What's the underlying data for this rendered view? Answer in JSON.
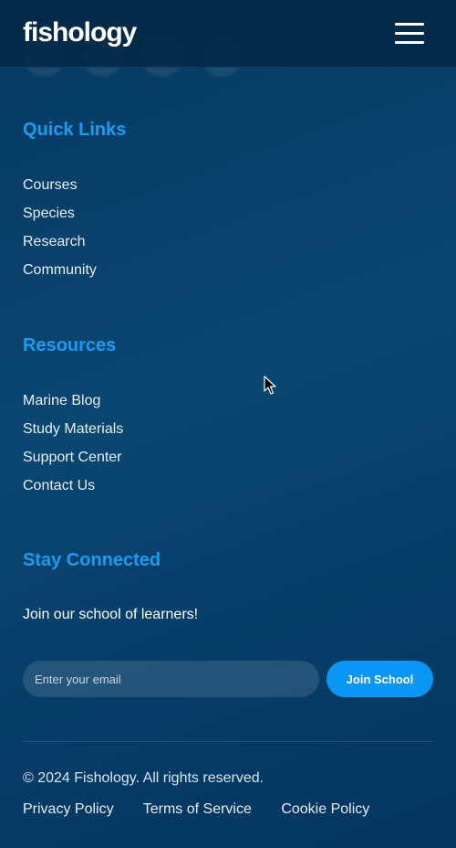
{
  "header": {
    "logo": "fishology",
    "menu_icon": "hamburger-menu-icon"
  },
  "social": {
    "icons": [
      "social-icon",
      "social-icon",
      "social-icon",
      "social-icon"
    ]
  },
  "quick_links": {
    "title": "Quick Links",
    "items": [
      "Courses",
      "Species",
      "Research",
      "Community"
    ]
  },
  "resources": {
    "title": "Resources",
    "items": [
      "Marine Blog",
      "Study Materials",
      "Support Center",
      "Contact Us"
    ]
  },
  "stay_connected": {
    "title": "Stay Connected",
    "tagline": "Join our school of learners!",
    "email_placeholder": "Enter your email",
    "button_label": "Join School"
  },
  "footer": {
    "copyright": "© 2024 Fishology. All rights reserved.",
    "legal_links": [
      "Privacy Policy",
      "Terms of Service",
      "Cookie Policy"
    ]
  },
  "colors": {
    "accent": "#1a9cf0",
    "button": "#0a96f5",
    "background": "#063e69"
  }
}
